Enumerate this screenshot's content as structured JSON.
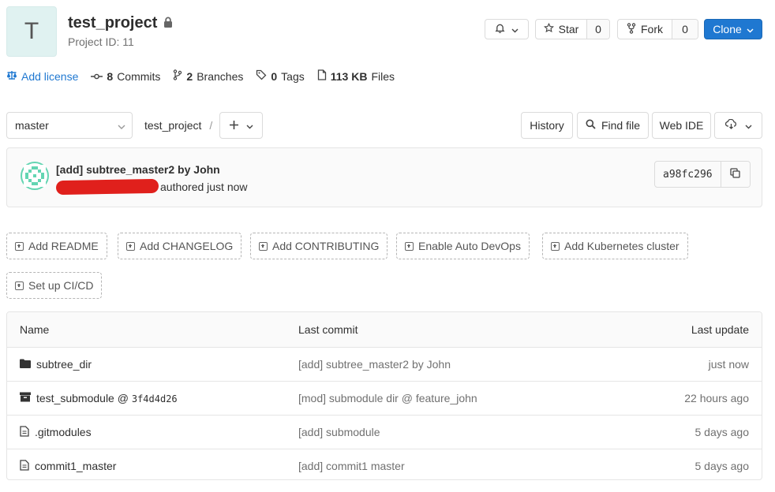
{
  "project": {
    "avatar_letter": "T",
    "name": "test_project",
    "id_text": "Project ID: 11"
  },
  "header_actions": {
    "star_label": "Star",
    "star_count": "0",
    "fork_label": "Fork",
    "fork_count": "0",
    "clone_label": "Clone"
  },
  "stats": {
    "add_license": "Add license",
    "commits_count": "8",
    "commits_label": "Commits",
    "branches_count": "2",
    "branches_label": "Branches",
    "tags_count": "0",
    "tags_label": "Tags",
    "files_size": "113 KB",
    "files_label": "Files"
  },
  "repo_nav": {
    "branch": "master",
    "breadcrumb_root": "test_project",
    "breadcrumb_sep": "/",
    "history_label": "History",
    "find_file_label": "Find file",
    "web_ide_label": "Web IDE"
  },
  "last_commit": {
    "title": "[add] subtree_master2 by John",
    "meta": "authored just now",
    "sha": "a98fc296"
  },
  "quick_actions": [
    "Add README",
    "Add CHANGELOG",
    "Add CONTRIBUTING",
    "Enable Auto DevOps",
    "Add Kubernetes cluster",
    "Set up CI/CD"
  ],
  "table": {
    "headers": {
      "name": "Name",
      "last_commit": "Last commit",
      "last_update": "Last update"
    },
    "rows": [
      {
        "icon": "folder-icon",
        "name": "subtree_dir",
        "suffix": "",
        "commit": "[add] subtree_master2 by John",
        "updated": "just now"
      },
      {
        "icon": "archive-icon",
        "name": "test_submodule @ ",
        "suffix": "3f4d4d26",
        "commit": "[mod] submodule dir @ feature_john",
        "updated": "22 hours ago"
      },
      {
        "icon": "file-icon",
        "name": ".gitmodules",
        "suffix": "",
        "commit": "[add] submodule",
        "updated": "5 days ago"
      },
      {
        "icon": "file-icon",
        "name": "commit1_master",
        "suffix": "",
        "commit": "[add] commit1 master",
        "updated": "5 days ago"
      }
    ]
  },
  "colors": {
    "accent": "#1f78d1",
    "avatar_bg": "#e0f2f1"
  }
}
